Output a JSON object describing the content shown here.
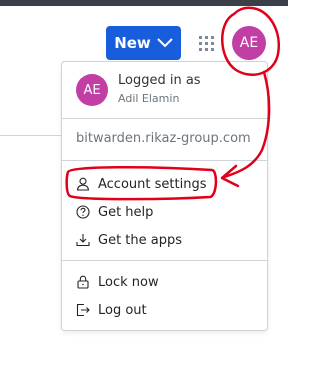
{
  "header": {
    "new_button_label": "New",
    "avatar_initials": "AE"
  },
  "account_menu": {
    "avatar_initials": "AE",
    "logged_in_label": "Logged in as",
    "user_name": "Adil Elamin",
    "server_url": "bitwarden.rikaz-group.com",
    "items": [
      {
        "label": "Account settings",
        "icon": "person-icon"
      },
      {
        "label": "Get help",
        "icon": "question-circle-icon"
      },
      {
        "label": "Get the apps",
        "icon": "download-icon"
      },
      {
        "label": "Lock now",
        "icon": "lock-icon"
      },
      {
        "label": "Log out",
        "icon": "sign-out-icon"
      }
    ]
  },
  "colors": {
    "brand_blue": "#175ddc",
    "avatar": "#c13fa4",
    "annotation_red": "#e0001a"
  }
}
